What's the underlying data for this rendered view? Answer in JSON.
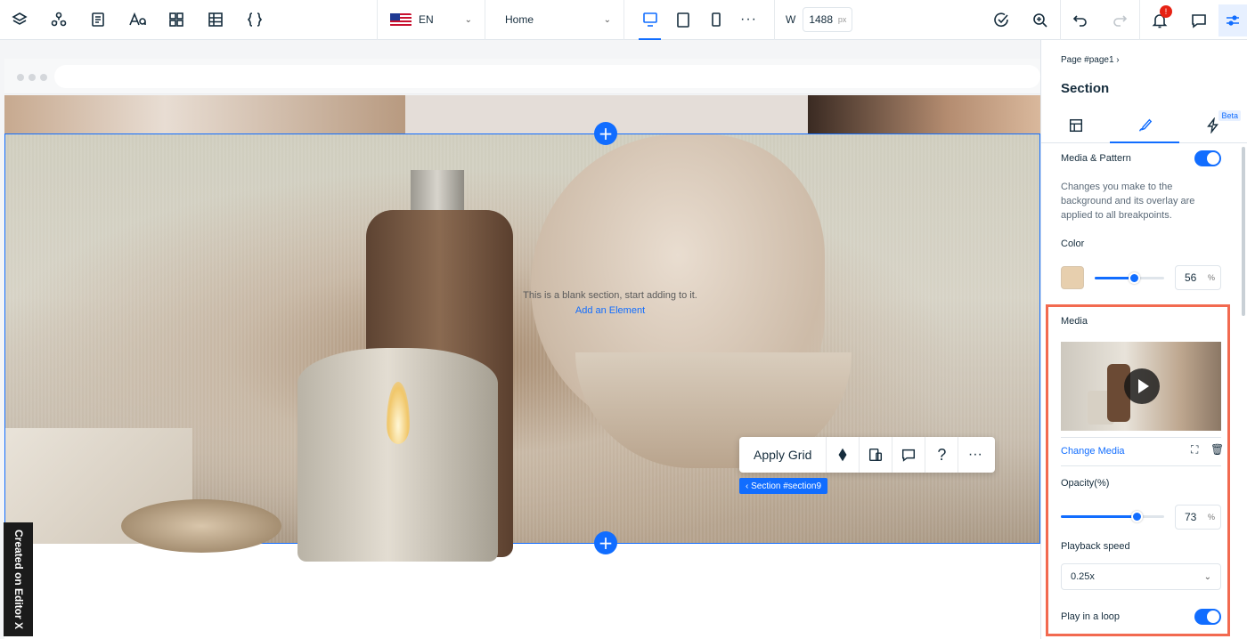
{
  "topbar": {
    "tools": [
      {
        "name": "layers-icon"
      },
      {
        "name": "components-icon"
      },
      {
        "name": "pages-icon"
      },
      {
        "name": "typography-icon"
      },
      {
        "name": "apps-icon"
      },
      {
        "name": "cms-table-icon"
      },
      {
        "name": "code-braces-icon"
      }
    ],
    "language": "EN",
    "page": "Home",
    "width_label": "W",
    "width_value": "1488",
    "width_unit": "px",
    "notifications_badge": "!"
  },
  "canvas": {
    "blank_section_text": "This is a blank section, start adding to it.",
    "add_element": "Add an Element",
    "floating_toolbar": {
      "apply_grid": "Apply Grid"
    },
    "section_tag": "‹ Section #section9",
    "created_on": "Created on Editor X"
  },
  "panel": {
    "breadcrumb": "Page #page1",
    "title": "Section",
    "beta": "Beta",
    "media_pattern_label": "Media & Pattern",
    "media_pattern_on": true,
    "description": "Changes you make to the background and its overlay are applied to all breakpoints.",
    "color_label": "Color",
    "color_swatch": "#e7cfae",
    "color_opacity": "56",
    "color_opacity_fraction": 0.56,
    "percent": "%",
    "media_label": "Media",
    "change_media": "Change Media",
    "opacity_label": "Opacity(%)",
    "media_opacity": "73",
    "media_opacity_fraction": 0.73,
    "playback_label": "Playback speed",
    "playback_value": "0.25x",
    "loop_label": "Play in a loop",
    "loop_on": true
  },
  "colors": {
    "accent": "#116dff",
    "highlight": "#f26a50",
    "alert": "#e62214"
  }
}
